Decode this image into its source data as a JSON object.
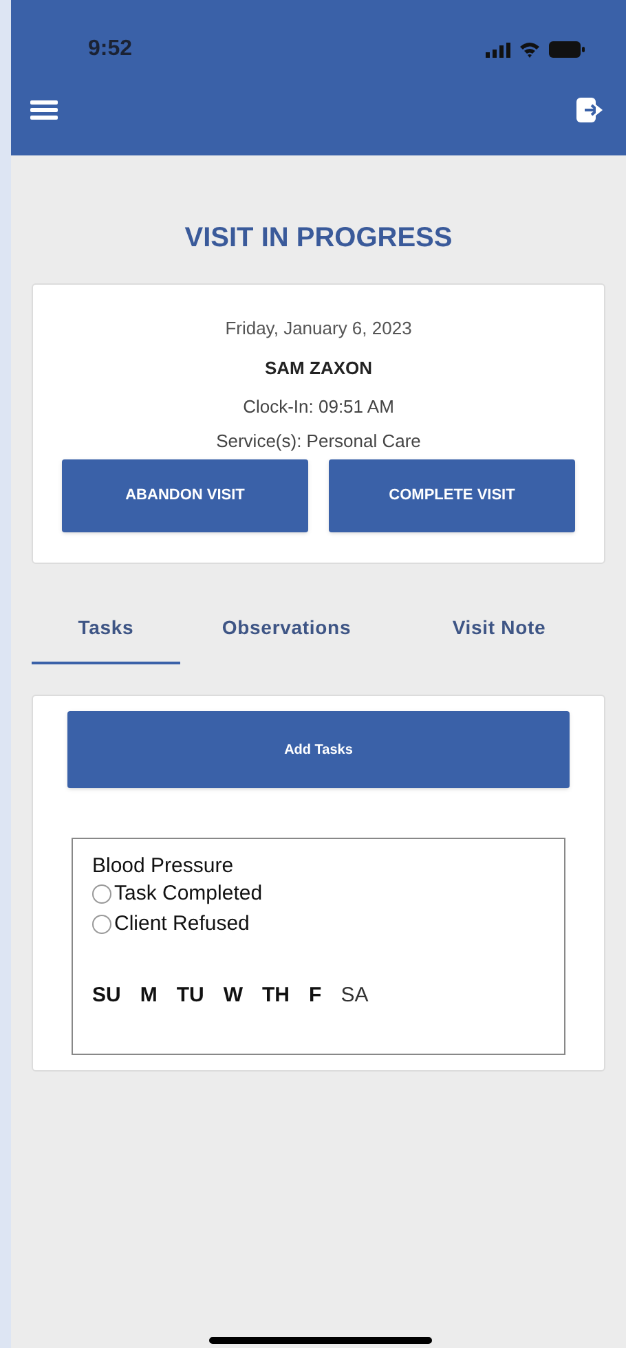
{
  "status_bar": {
    "time": "9:52"
  },
  "title": "VISIT IN PROGRESS",
  "visit": {
    "date": "Friday, January 6, 2023",
    "client": "SAM ZAXON",
    "clock_in": "Clock-In: 09:51 AM",
    "services": "Service(s): Personal Care"
  },
  "actions": [
    "ABANDON VISIT",
    "COMPLETE VISIT"
  ],
  "tabs": [
    {
      "label": "Tasks",
      "selected": true
    },
    {
      "label": "Observations",
      "selected": false
    },
    {
      "label": "Visit Note",
      "selected": false
    }
  ],
  "add_button": "Add Tasks",
  "task": {
    "name": "Blood Pressure",
    "options": [
      {
        "label": "Task Completed",
        "selected": false
      },
      {
        "label": "Client Refused",
        "selected": false
      }
    ],
    "days": [
      {
        "label": "SU",
        "active": true
      },
      {
        "label": "M",
        "active": true
      },
      {
        "label": "TU",
        "active": true
      },
      {
        "label": "W",
        "active": true
      },
      {
        "label": "TH",
        "active": true
      },
      {
        "label": "F",
        "active": true
      },
      {
        "label": "SA",
        "active": false
      }
    ]
  }
}
